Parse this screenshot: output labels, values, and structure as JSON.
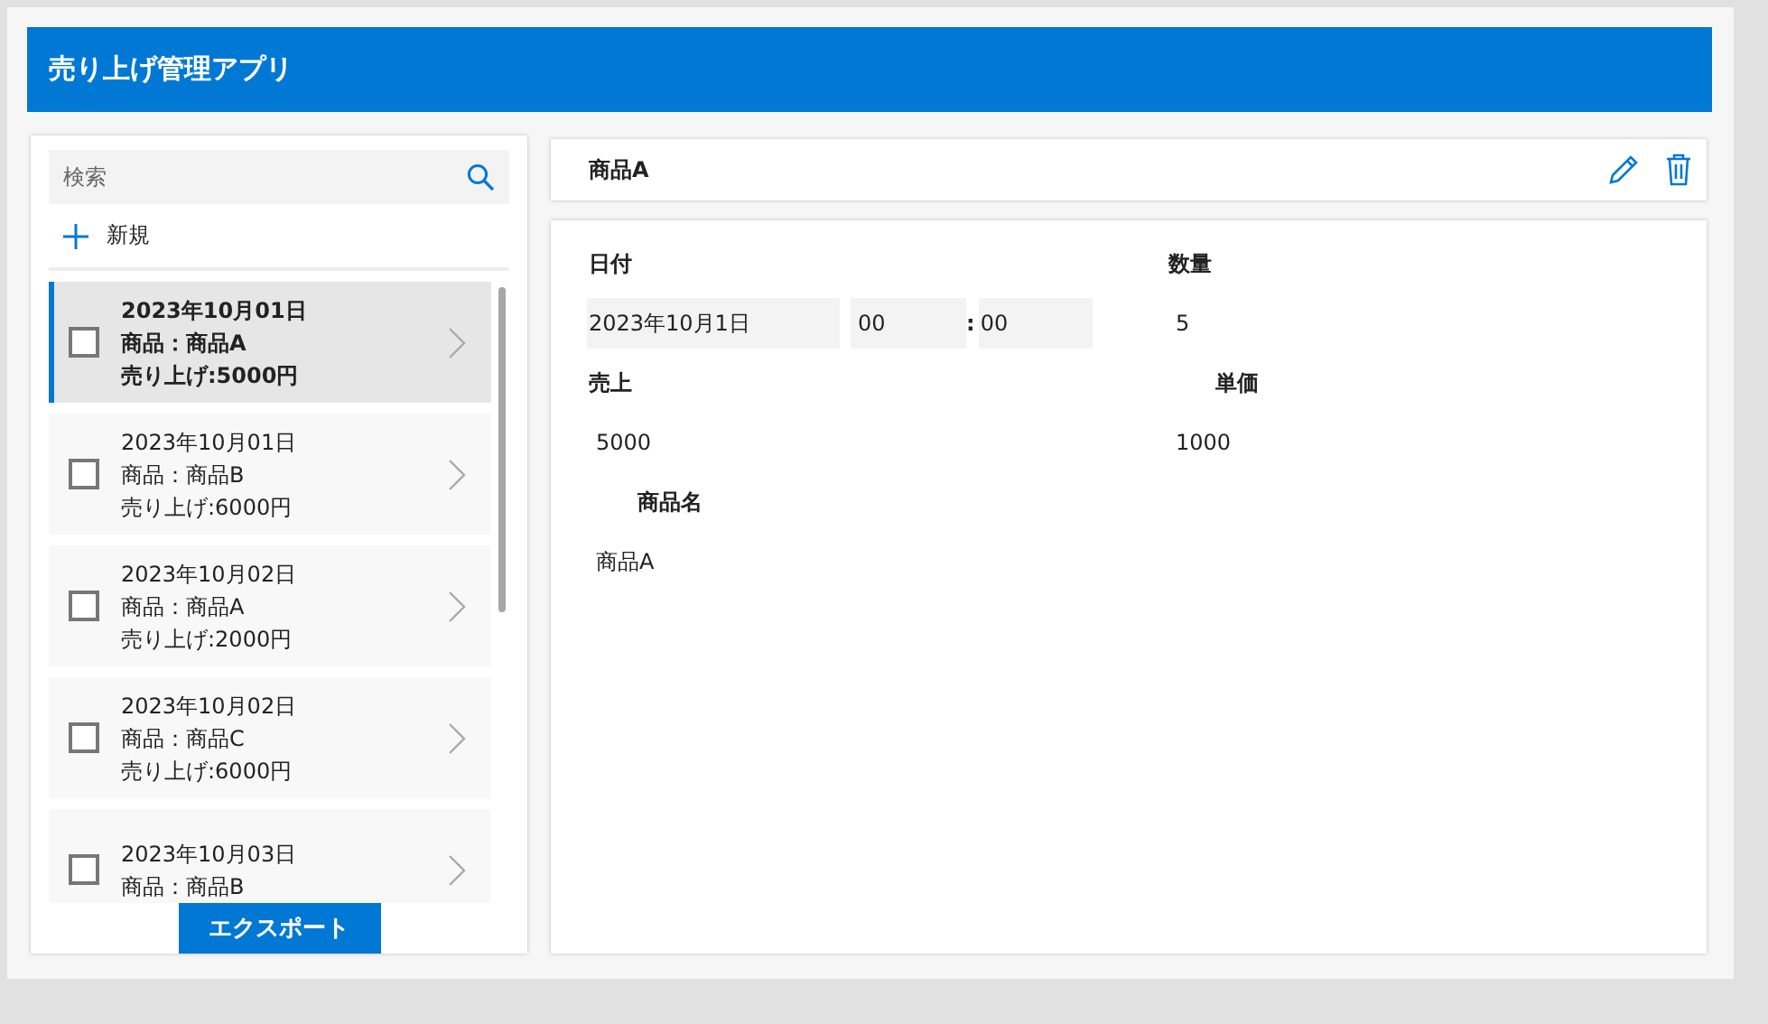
{
  "header": {
    "title": "売り上げ管理アプリ"
  },
  "sidebar": {
    "search": {
      "placeholder": "検索"
    },
    "new_button": {
      "label": "新規"
    },
    "items": [
      {
        "date": "2023年10月01日",
        "product": "商品：商品A",
        "sales": "売り上げ:5000円",
        "selected": true,
        "checked": false
      },
      {
        "date": "2023年10月01日",
        "product": "商品：商品B",
        "sales": "売り上げ:6000円",
        "selected": false,
        "checked": false
      },
      {
        "date": "2023年10月02日",
        "product": "商品：商品A",
        "sales": "売り上げ:2000円",
        "selected": false,
        "checked": false
      },
      {
        "date": "2023年10月02日",
        "product": "商品：商品C",
        "sales": "売り上げ:6000円",
        "selected": false,
        "checked": false
      },
      {
        "date": "2023年10月03日",
        "product": "商品：商品B",
        "selected": false,
        "checked": false
      }
    ],
    "export_button": {
      "label": "エクスポート"
    }
  },
  "detail": {
    "title": "商品A",
    "date": {
      "label": "日付",
      "value": "2023年10月1日",
      "hour": "00",
      "separator": ":",
      "minute": "00"
    },
    "quantity": {
      "label": "数量",
      "value": "5"
    },
    "sales": {
      "label": "売上",
      "value": "5000"
    },
    "unit_price": {
      "label": "単価",
      "value": "1000"
    },
    "product_name": {
      "label": "商品名",
      "value": "商品A"
    }
  }
}
